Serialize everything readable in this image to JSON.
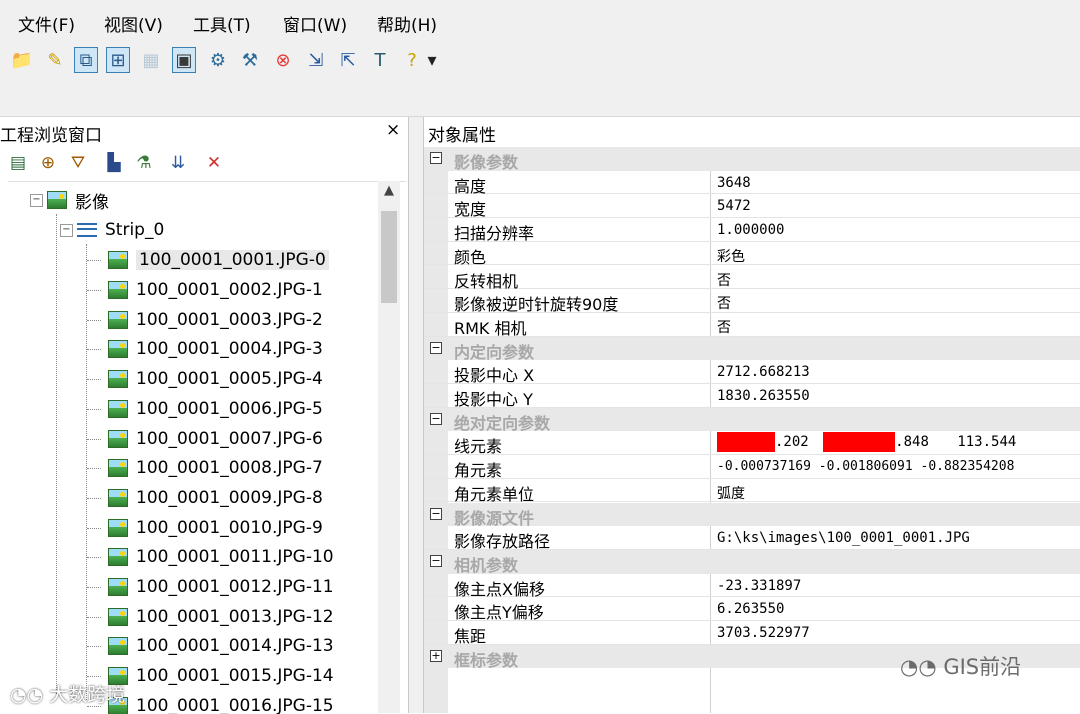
{
  "menu": [
    "文件(F)",
    "视图(V)",
    "工具(T)",
    "窗口(W)",
    "帮助(H)"
  ],
  "toolbar_icons": [
    "open-folder-icon",
    "open-project-icon",
    "view-image-icon",
    "view-tie-icon",
    "disabled-icon",
    "view-3d-icon",
    "tools-icon",
    "settings-icon",
    "stop-icon",
    "import-icon",
    "export-icon",
    "tee-icon",
    "help-icon",
    "more-icon"
  ],
  "left_pane": {
    "title": "工程浏览窗口",
    "close": "×",
    "tree_toolbar": [
      "screen-icon",
      "crosshair-icon",
      "tripod-icon",
      "measure-icon",
      "adjust-icon",
      "merge-icon",
      "delete-icon"
    ],
    "root_label": "影像",
    "strip_label": "Strip_0",
    "images": [
      "100_0001_0001.JPG-0",
      "100_0001_0002.JPG-1",
      "100_0001_0003.JPG-2",
      "100_0001_0004.JPG-3",
      "100_0001_0005.JPG-4",
      "100_0001_0006.JPG-5",
      "100_0001_0007.JPG-6",
      "100_0001_0008.JPG-7",
      "100_0001_0009.JPG-8",
      "100_0001_0010.JPG-9",
      "100_0001_0011.JPG-10",
      "100_0001_0012.JPG-11",
      "100_0001_0013.JPG-12",
      "100_0001_0014.JPG-13",
      "100_0001_0015.JPG-14",
      "100_0001_0016.JPG-15"
    ]
  },
  "right_pane": {
    "title": "对象属性",
    "rows": [
      {
        "type": "section",
        "name": "影像参数",
        "expander": "⊟"
      },
      {
        "type": "prop",
        "name": "高度",
        "value": "3648"
      },
      {
        "type": "prop",
        "name": "宽度",
        "value": "5472"
      },
      {
        "type": "prop",
        "name": "扫描分辨率",
        "value": "1.000000"
      },
      {
        "type": "prop",
        "name": "颜色",
        "value": "彩色"
      },
      {
        "type": "prop",
        "name": "反转相机",
        "value": "否"
      },
      {
        "type": "prop",
        "name": "影像被逆时针旋转90度",
        "value": "否"
      },
      {
        "type": "prop",
        "name": "RMK 相机",
        "value": "否"
      },
      {
        "type": "section",
        "name": "内定向参数",
        "expander": "⊟"
      },
      {
        "type": "prop",
        "name": "投影中心 X",
        "value": "2712.668213"
      },
      {
        "type": "prop",
        "name": "投影中心 Y",
        "value": "1830.263550"
      },
      {
        "type": "section",
        "name": "绝对定向参数",
        "expander": "⊟"
      },
      {
        "type": "prop",
        "name": "线元素",
        "value": "",
        "redacted": true,
        "parts": [
          ".202",
          ".848",
          "113.544"
        ]
      },
      {
        "type": "prop",
        "name": "角元素",
        "value": "-0.000737169 -0.001806091 -0.882354208"
      },
      {
        "type": "prop",
        "name": "角元素单位",
        "value": "弧度"
      },
      {
        "type": "section",
        "name": "影像源文件",
        "expander": "⊟"
      },
      {
        "type": "prop",
        "name": "影像存放路径",
        "value": "G:\\ks\\images\\100_0001_0001.JPG"
      },
      {
        "type": "section",
        "name": "相机参数",
        "expander": "⊟"
      },
      {
        "type": "prop",
        "name": "像主点X偏移",
        "value": "-23.331897"
      },
      {
        "type": "prop",
        "name": "像主点Y偏移",
        "value": "6.263550"
      },
      {
        "type": "prop",
        "name": "焦距",
        "value": "3703.522977"
      },
      {
        "type": "section",
        "name": "框标参数",
        "expander": "⊞"
      }
    ]
  },
  "watermarks": [
    "GIS前沿",
    "大数跨境"
  ],
  "colors": {
    "redaction": "#ff0000",
    "section_bg": "#e8e8e8",
    "section_text": "#a8a8a8"
  }
}
